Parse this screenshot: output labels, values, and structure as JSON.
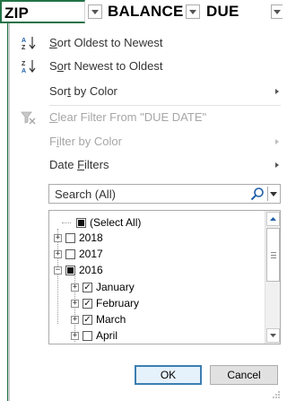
{
  "header": {
    "columns": [
      {
        "label": "ZIP"
      },
      {
        "label": "BALANCE"
      },
      {
        "label": "DUE DATE"
      }
    ]
  },
  "menu": {
    "sort_oldest": {
      "pre": "",
      "ul": "S",
      "post": "ort Oldest to Newest"
    },
    "sort_newest": {
      "pre": "S",
      "ul": "o",
      "post": "rt Newest to Oldest"
    },
    "sort_color": {
      "pre": "Sor",
      "ul": "t",
      "post": " by Color"
    },
    "clear_filter": {
      "pre": "",
      "ul": "C",
      "post": "lear Filter From \"DUE DATE\""
    },
    "filter_color": {
      "pre": "F",
      "ul": "i",
      "post": "lter by Color"
    },
    "date_filters": {
      "pre": "Date ",
      "ul": "F",
      "post": "ilters"
    }
  },
  "search": {
    "placeholder": "Search (All)"
  },
  "tree": {
    "select_all": "(Select All)",
    "y2018": "2018",
    "y2017": "2017",
    "y2016": "2016",
    "january": "January",
    "february": "February",
    "march": "March",
    "april": "April"
  },
  "buttons": {
    "ok": "OK",
    "cancel": "Cancel"
  },
  "colors": {
    "accent": "#217346",
    "ok_border": "#3c7fb1"
  }
}
